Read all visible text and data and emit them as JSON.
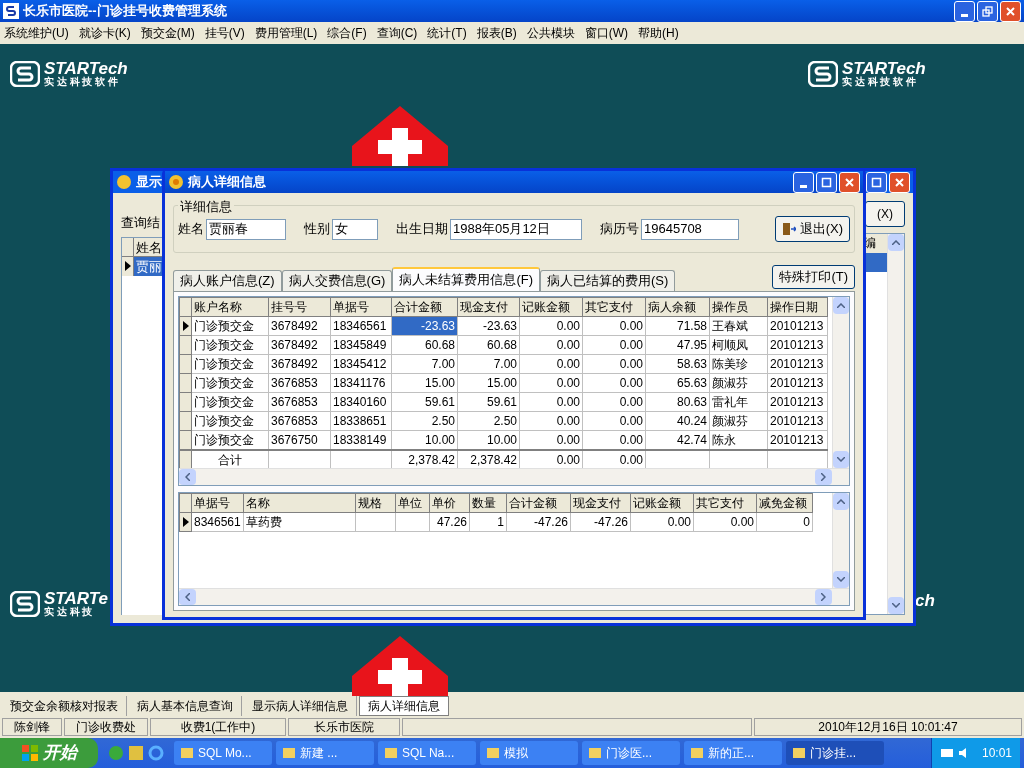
{
  "window": {
    "title": "长乐市医院--门诊挂号收费管理系统"
  },
  "menu": [
    "系统维护(U)",
    "就诊卡(K)",
    "预交金(M)",
    "挂号(V)",
    "费用管理(L)",
    "综合(F)",
    "查询(C)",
    "统计(T)",
    "报表(B)",
    "公共模块",
    "窗口(W)",
    "帮助(H)"
  ],
  "logos": [
    {
      "name": "STARTech",
      "tagline": "实 达 科 技 软 件"
    },
    {
      "name": "STARTech",
      "tagline": "实 达 科 技 软 件"
    },
    {
      "name": "STARTe",
      "tagline": "实 达 科 技"
    }
  ],
  "logo_fragment": "ch",
  "background_window": {
    "title": "显示",
    "label": "查询结",
    "column_1": "姓名",
    "column_2": "编",
    "row_1": "贾丽",
    "button": "(X)"
  },
  "dialog": {
    "title": "病人详细信息",
    "group": "详细信息",
    "fields": [
      {
        "label": "姓名",
        "value": "贾丽春"
      },
      {
        "label": "性别",
        "value": "女"
      },
      {
        "label": "出生日期",
        "value": "1988年05月12日"
      },
      {
        "label": "病历号",
        "value": "19645708"
      }
    ],
    "exit_button": "退出(X)",
    "tabs": [
      {
        "label": "病人账户信息(Z)",
        "selected": false
      },
      {
        "label": "病人交费信息(G)",
        "selected": false
      },
      {
        "label": "病人未结算费用信息(F)",
        "selected": true
      },
      {
        "label": "病人已结算的费用(S)",
        "selected": false
      }
    ],
    "print_button": "特殊打印(T)",
    "accounts_table": {
      "columns": [
        {
          "label": "账户名称",
          "kind": "text"
        },
        {
          "label": "挂号号",
          "kind": "text"
        },
        {
          "label": "单据号",
          "kind": "text"
        },
        {
          "label": "合计金额",
          "kind": "number"
        },
        {
          "label": "现金支付",
          "kind": "number"
        },
        {
          "label": "记账金额",
          "kind": "number"
        },
        {
          "label": "其它支付",
          "kind": "number"
        },
        {
          "label": "病人余额",
          "kind": "number"
        },
        {
          "label": "操作员",
          "kind": "text"
        },
        {
          "label": "操作日期",
          "kind": "text"
        }
      ],
      "rows": [
        {
          "selected": true,
          "cells": [
            "门诊预交金",
            "3678492",
            "18346561",
            "-23.63",
            "-23.63",
            "0.00",
            "0.00",
            "71.58",
            "王春斌",
            "20101213"
          ]
        },
        {
          "selected": false,
          "cells": [
            "门诊预交金",
            "3678492",
            "18345849",
            "60.68",
            "60.68",
            "0.00",
            "0.00",
            "47.95",
            "柯顺凤",
            "20101213"
          ]
        },
        {
          "selected": false,
          "cells": [
            "门诊预交金",
            "3678492",
            "18345412",
            "7.00",
            "7.00",
            "0.00",
            "0.00",
            "58.63",
            "陈美珍",
            "20101213"
          ]
        },
        {
          "selected": false,
          "cells": [
            "门诊预交金",
            "3676853",
            "18341176",
            "15.00",
            "15.00",
            "0.00",
            "0.00",
            "65.63",
            "颜淑芬",
            "20101213"
          ]
        },
        {
          "selected": false,
          "cells": [
            "门诊预交金",
            "3676853",
            "18340160",
            "59.61",
            "59.61",
            "0.00",
            "0.00",
            "80.63",
            "雷礼年",
            "20101213"
          ]
        },
        {
          "selected": false,
          "cells": [
            "门诊预交金",
            "3676853",
            "18338651",
            "2.50",
            "2.50",
            "0.00",
            "0.00",
            "40.24",
            "颜淑芬",
            "20101213"
          ]
        },
        {
          "selected": false,
          "cells": [
            "门诊预交金",
            "3676750",
            "18338149",
            "10.00",
            "10.00",
            "0.00",
            "0.00",
            "42.74",
            "陈永",
            "20101213"
          ]
        }
      ],
      "totals": {
        "label": "合计",
        "total_amount": "2,378.42",
        "cash_paid": "2,378.42",
        "billed_amount": "0.00",
        "other_paid": "0.00"
      }
    },
    "items_table": {
      "columns": [
        {
          "label": "单据号",
          "kind": "text"
        },
        {
          "label": "名称",
          "kind": "text"
        },
        {
          "label": "规格",
          "kind": "text"
        },
        {
          "label": "单位",
          "kind": "text"
        },
        {
          "label": "单价",
          "kind": "number"
        },
        {
          "label": "数量",
          "kind": "number"
        },
        {
          "label": "合计金额",
          "kind": "number"
        },
        {
          "label": "现金支付",
          "kind": "number"
        },
        {
          "label": "记账金额",
          "kind": "number"
        },
        {
          "label": "其它支付",
          "kind": "number"
        },
        {
          "label": "减免金额",
          "kind": "number"
        }
      ],
      "rows": [
        {
          "selected": true,
          "cells": [
            "8346561",
            "草药费",
            "",
            "",
            "47.26",
            "1",
            "-47.26",
            "-47.26",
            "0.00",
            "0.00",
            "0"
          ]
        }
      ]
    }
  },
  "mdi_tabs": [
    {
      "label": "预交金余额核对报表",
      "selected": false
    },
    {
      "label": "病人基本信息查询",
      "selected": false
    },
    {
      "label": "显示病人详细信息",
      "selected": false
    },
    {
      "label": "病人详细信息",
      "selected": true
    }
  ],
  "status_bar": [
    "陈剑锋",
    "门诊收费处",
    "收费1(工作中)",
    "长乐市医院",
    "2010年12月16日 10:01:47"
  ],
  "taskbar": {
    "start": "开始",
    "tasks": [
      {
        "label": "SQL Mo...",
        "selected": false
      },
      {
        "label": "新建 ...",
        "selected": false
      },
      {
        "label": "SQL Na...",
        "selected": false
      },
      {
        "label": "模拟",
        "selected": false
      },
      {
        "label": "门诊医...",
        "selected": false
      },
      {
        "label": "新的正...",
        "selected": false
      },
      {
        "label": "门诊挂...",
        "selected": true
      }
    ],
    "clock": "10:01"
  }
}
